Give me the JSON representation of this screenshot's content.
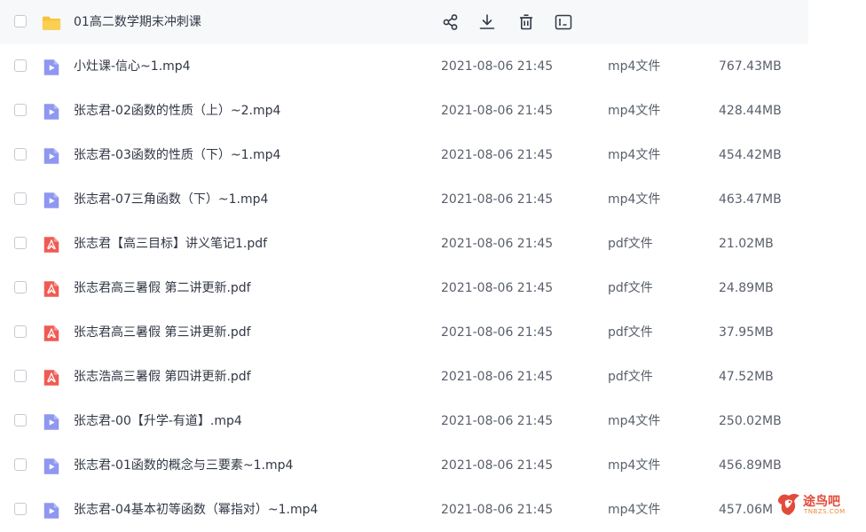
{
  "folder": {
    "name": "01高二数学期末冲刺课",
    "actions": [
      "share-icon",
      "download-icon",
      "delete-icon",
      "rename-icon"
    ]
  },
  "files": [
    {
      "name": "小灶课-信心~1.mp4",
      "date": "2021-08-06 21:45",
      "type": "mp4文件",
      "size": "767.43MB",
      "kind": "video"
    },
    {
      "name": "张志君-02函数的性质（上）~2.mp4",
      "date": "2021-08-06 21:45",
      "type": "mp4文件",
      "size": "428.44MB",
      "kind": "video"
    },
    {
      "name": "张志君-03函数的性质（下）~1.mp4",
      "date": "2021-08-06 21:45",
      "type": "mp4文件",
      "size": "454.42MB",
      "kind": "video"
    },
    {
      "name": "张志君-07三角函数（下）~1.mp4",
      "date": "2021-08-06 21:45",
      "type": "mp4文件",
      "size": "463.47MB",
      "kind": "video"
    },
    {
      "name": "张志君【高三目标】讲义笔记1.pdf",
      "date": "2021-08-06 21:45",
      "type": "pdf文件",
      "size": "21.02MB",
      "kind": "pdf"
    },
    {
      "name": "张志君高三暑假 第二讲更新.pdf",
      "date": "2021-08-06 21:45",
      "type": "pdf文件",
      "size": "24.89MB",
      "kind": "pdf"
    },
    {
      "name": "张志君高三暑假 第三讲更新.pdf",
      "date": "2021-08-06 21:45",
      "type": "pdf文件",
      "size": "37.95MB",
      "kind": "pdf"
    },
    {
      "name": "张志浩高三暑假  第四讲更新.pdf",
      "date": "2021-08-06 21:45",
      "type": "pdf文件",
      "size": "47.52MB",
      "kind": "pdf"
    },
    {
      "name": "张志君-00【升学-有道】.mp4",
      "date": "2021-08-06 21:45",
      "type": "mp4文件",
      "size": "250.02MB",
      "kind": "video"
    },
    {
      "name": "张志君-01函数的概念与三要素~1.mp4",
      "date": "2021-08-06 21:45",
      "type": "mp4文件",
      "size": "456.89MB",
      "kind": "video"
    },
    {
      "name": "张志君-04基本初等函数（幂指对）~1.mp4",
      "date": "2021-08-06 21:45",
      "type": "mp4文件",
      "size": "457.06M",
      "kind": "video"
    }
  ],
  "watermark": {
    "text": "途鸟吧",
    "sub": "TNBZS.COM"
  },
  "colors": {
    "folder": "#f8c23a",
    "video": "#8f97f0",
    "pdf": "#ef5b54",
    "row_hover": "#f7f8fa"
  }
}
